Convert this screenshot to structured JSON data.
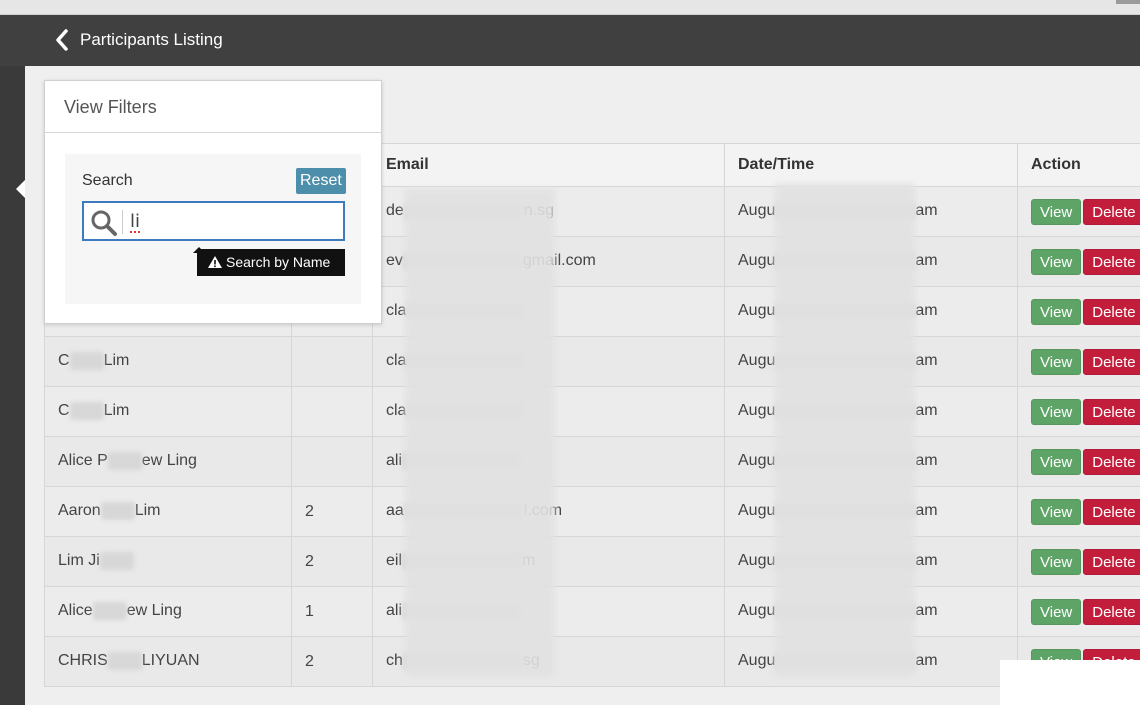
{
  "header": {
    "title": "Participants Listing"
  },
  "filters": {
    "title": "View Filters",
    "search_label": "Search",
    "reset_label": "Reset",
    "search_value": "li",
    "tooltip": "Search by Name"
  },
  "table": {
    "columns": [
      "",
      "",
      "Email",
      "Date/Time",
      "Action"
    ],
    "view_label": "View",
    "delete_label": "Delete",
    "rows": [
      {
        "name": "",
        "team": "",
        "email_prefix": "de",
        "email_suffix": "n.sg",
        "date_prefix": "Augu",
        "date_suffix": "am"
      },
      {
        "name": "",
        "team": "",
        "email_prefix": "ev",
        "email_suffix": "gmail.com",
        "date_prefix": "Augu",
        "date_suffix": "am"
      },
      {
        "name": "",
        "team": "",
        "email_prefix": "cla",
        "email_suffix": "",
        "date_prefix": "Augu",
        "date_suffix": "am"
      },
      {
        "name_prefix": "C",
        "name_suffix": "Lim",
        "team": "",
        "email_prefix": "cla",
        "email_suffix": "",
        "date_prefix": "Augu",
        "date_suffix": "am"
      },
      {
        "name_prefix": "C",
        "name_suffix": "Lim",
        "team": "",
        "email_prefix": "cla",
        "email_suffix": "",
        "date_prefix": "Augu",
        "date_suffix": "am"
      },
      {
        "name_prefix": "Alice P",
        "name_suffix": "ew Ling",
        "team": "",
        "email_prefix": "ali",
        "email_suffix": "",
        "date_prefix": "Augu",
        "date_suffix": "am"
      },
      {
        "name_prefix": "Aaron",
        "name_suffix": "Lim",
        "team": "2",
        "email_prefix": "aa",
        "email_suffix": "l.com",
        "date_prefix": "Augu",
        "date_suffix": "am"
      },
      {
        "name_prefix": "Lim Ji",
        "name_suffix": "",
        "team": "2",
        "email_prefix": "eil",
        "email_suffix": "m",
        "date_prefix": "Augu",
        "date_suffix": "am"
      },
      {
        "name_prefix": "Alice",
        "name_suffix": "ew Ling",
        "team": "1",
        "email_prefix": "ali",
        "email_suffix": "",
        "date_prefix": "Augu",
        "date_suffix": "am"
      },
      {
        "name_prefix": "CHRIS",
        "name_suffix": "LIYUAN",
        "team": "2",
        "email_prefix": "ch",
        "email_suffix": "sg",
        "date_prefix": "Augu",
        "date_suffix": "am"
      }
    ]
  },
  "colors": {
    "header_bg": "#404040",
    "view_button": "#5fa467",
    "delete_button": "#c21e3c",
    "reset_button": "#4d8eaa",
    "search_border": "#3d7bbf"
  },
  "icons": {
    "back": "chevron-left-icon",
    "search": "search-icon",
    "warning": "warning-icon",
    "sidebar_toggle": "caret-left-icon"
  }
}
